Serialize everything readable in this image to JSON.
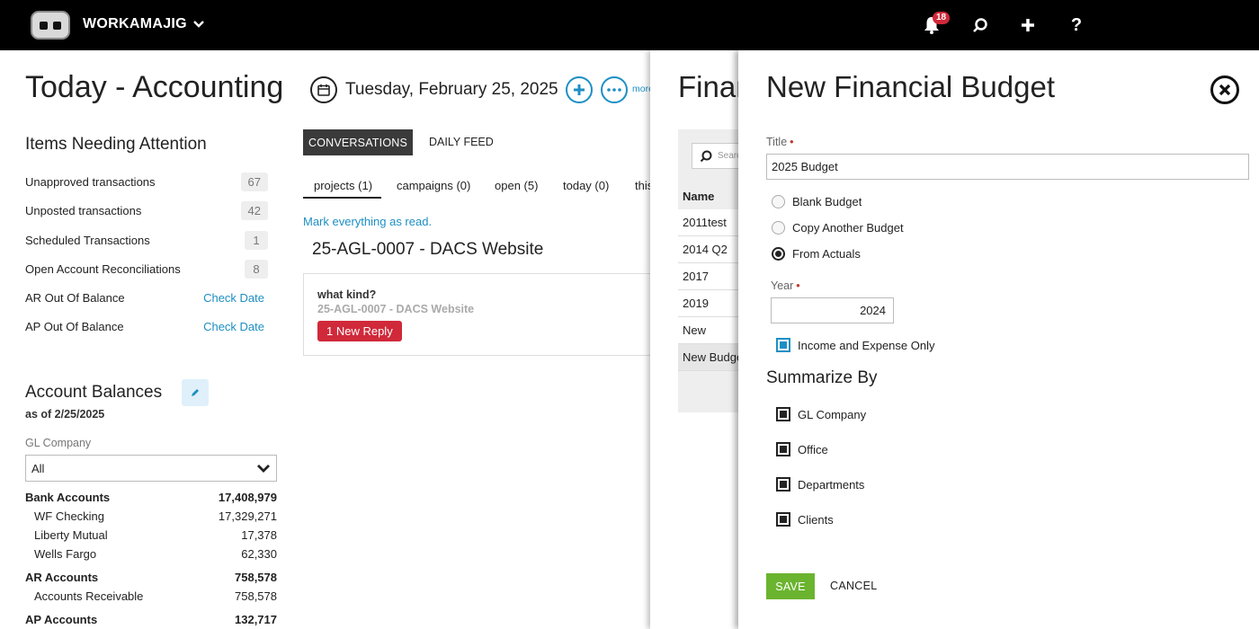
{
  "topbar": {
    "brand": "WORKAMAJIG",
    "notifications_count": "18",
    "icons": [
      "bell-icon",
      "search-icon",
      "plus-icon",
      "help-icon"
    ]
  },
  "page": {
    "title": "Today - Accounting",
    "date": "Tuesday, February 25, 2025",
    "more": "more"
  },
  "attention": {
    "title": "Items Needing Attention",
    "items": [
      {
        "label": "Unapproved transactions",
        "value": "67"
      },
      {
        "label": "Unposted transactions",
        "value": "42"
      },
      {
        "label": "Scheduled Transactions",
        "value": "1"
      },
      {
        "label": "Open Account Reconciliations",
        "value": "8"
      },
      {
        "label": "AR Out Of Balance",
        "link": "Check Date"
      },
      {
        "label": "AP Out Of Balance",
        "link": "Check Date"
      }
    ]
  },
  "balances": {
    "title": "Account Balances",
    "as_of": "as of 2/25/2025",
    "gl_label": "GL Company",
    "gl_value": "All",
    "rows": [
      {
        "label": "Bank Accounts",
        "value": "17,408,979"
      },
      {
        "label": "WF Checking",
        "value": "17,329,271"
      },
      {
        "label": "Liberty Mutual",
        "value": "17,378"
      },
      {
        "label": "Wells Fargo",
        "value": "62,330"
      },
      {
        "label": "AR Accounts",
        "value": "758,578"
      },
      {
        "label": "Accounts Receivable",
        "value": "758,578"
      },
      {
        "label": "AP Accounts",
        "value": "132,717"
      }
    ]
  },
  "conversations": {
    "tabs": [
      "CONVERSATIONS",
      "DAILY FEED"
    ],
    "subtabs": [
      "projects (1)",
      "campaigns (0)",
      "open (5)",
      "today (0)",
      "this"
    ],
    "mark_read": "Mark everything as read.",
    "project_title": "25-AGL-0007 - DACS Website",
    "card": {
      "question": "what kind?",
      "subtitle": "25-AGL-0007 - DACS Website",
      "reply": "1 New Reply"
    }
  },
  "financial": {
    "title": "Finan",
    "search_placeholder": "Search",
    "column": "Name",
    "rows": [
      "2011test",
      "2014 Q2",
      "2017",
      "2019",
      "New",
      "New Budget"
    ]
  },
  "modal": {
    "title": "New Financial Budget",
    "title_label": "Title",
    "title_value": "2025 Budget",
    "options": [
      "Blank Budget",
      "Copy Another Budget",
      "From Actuals"
    ],
    "year_label": "Year",
    "year_value": "2024",
    "income_only": "Income and Expense Only",
    "summarize_title": "Summarize By",
    "summarize": [
      "GL Company",
      "Office",
      "Departments",
      "Clients"
    ],
    "save": "SAVE",
    "cancel": "CANCEL"
  }
}
